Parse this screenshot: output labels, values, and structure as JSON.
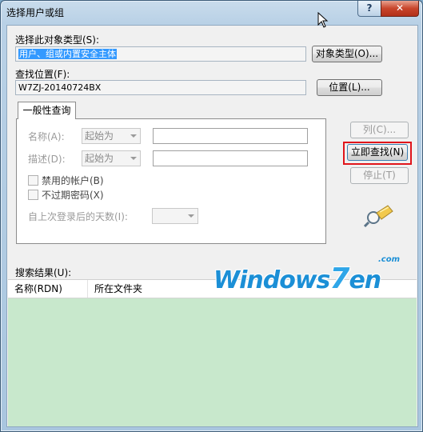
{
  "window": {
    "title": "选择用户或组",
    "help_label": "?",
    "close_label": "✕"
  },
  "object_types": {
    "label": "选择此对象类型(S):",
    "value": "用户、组或内置安全主体",
    "button": "对象类型(O)..."
  },
  "location": {
    "label": "查找位置(F):",
    "value": "W7ZJ-20140724BX",
    "button": "位置(L)..."
  },
  "tab": {
    "label": "一般性查询"
  },
  "query": {
    "name_label": "名称(A):",
    "name_mode": "起始为",
    "desc_label": "描述(D):",
    "desc_mode": "起始为",
    "disabled_accounts": "禁用的帐户(B)",
    "no_expire_pwd": "不过期密码(X)",
    "days_label": "自上次登录后的天数(I):"
  },
  "buttons": {
    "columns": "列(C)...",
    "find_now": "立即查找(N)",
    "stop": "停止(T)"
  },
  "results": {
    "label": "搜索结果(U):",
    "columns": [
      "名称(RDN)",
      "所在文件夹"
    ]
  },
  "watermark": {
    "text": "Windows",
    "seven": "7",
    "tail": "en",
    "sub": ".com"
  },
  "colors": {
    "highlight": "#e0151b",
    "results_bg": "#c8e8cc",
    "selection": "#3399ff"
  }
}
